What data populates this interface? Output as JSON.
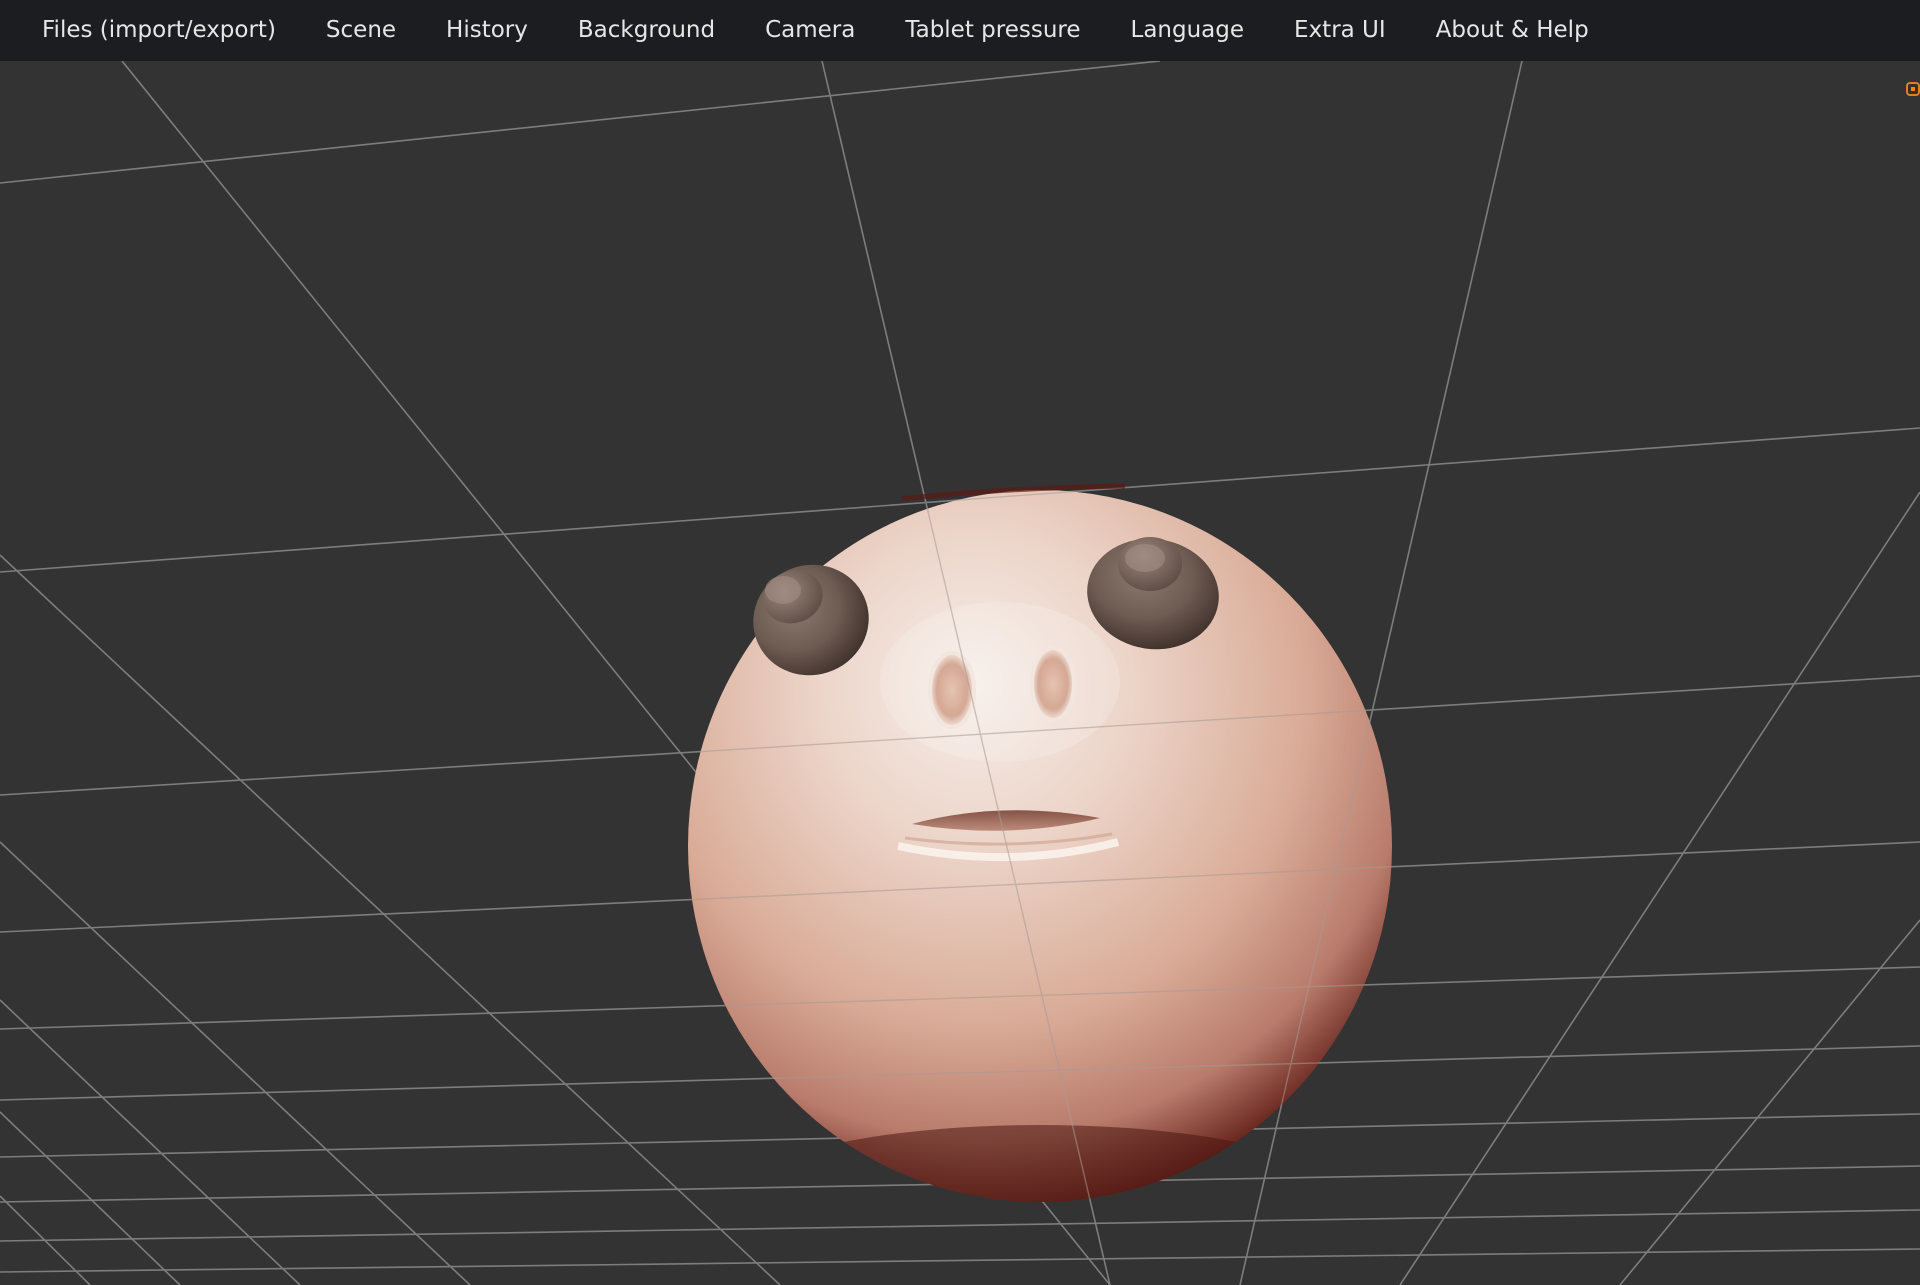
{
  "menu": {
    "items": [
      {
        "label": "Files (import/export)"
      },
      {
        "label": "Scene"
      },
      {
        "label": "History"
      },
      {
        "label": "Background"
      },
      {
        "label": "Camera"
      },
      {
        "label": "Tablet pressure"
      },
      {
        "label": "Language"
      },
      {
        "label": "Extra UI"
      },
      {
        "label": "About & Help"
      }
    ]
  },
  "colors": {
    "menubar": "#1c1d20",
    "menu_text": "#e6e6e6",
    "viewport_bg": "#333333",
    "grid": "#8a8a8a",
    "accent": "#d9822b",
    "skin_light": "#f3e8e2",
    "skin_mid": "#d9a795",
    "skin_dark": "#5a1a14"
  },
  "viewport": {
    "icons": {
      "corner_toggle": "orange-square-toggle-icon"
    }
  }
}
